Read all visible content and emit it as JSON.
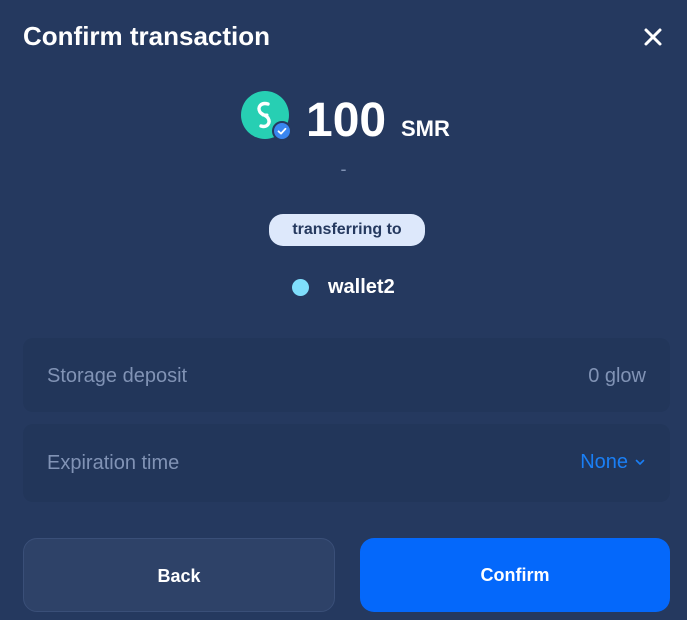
{
  "dialog": {
    "title": "Confirm transaction",
    "close_icon": "close-icon"
  },
  "transaction": {
    "token_icon": "shimmer-token-icon",
    "verified_icon": "verified-check-icon",
    "amount": "100",
    "unit": "SMR",
    "fiat_value": "-",
    "direction_label": "transferring to",
    "recipient": {
      "name": "wallet2",
      "color": "#7fdefc"
    }
  },
  "details": {
    "storage_deposit": {
      "label": "Storage deposit",
      "value": "0 glow"
    },
    "expiration_time": {
      "label": "Expiration time",
      "value": "None",
      "icon": "chevron-down-icon"
    }
  },
  "actions": {
    "back_label": "Back",
    "confirm_label": "Confirm"
  },
  "colors": {
    "background": "#25395f",
    "panel": "#22365a",
    "accent": "#0468fb",
    "link": "#1a7ff5",
    "token": "#27cfb3",
    "muted_text": "#8193b5"
  }
}
